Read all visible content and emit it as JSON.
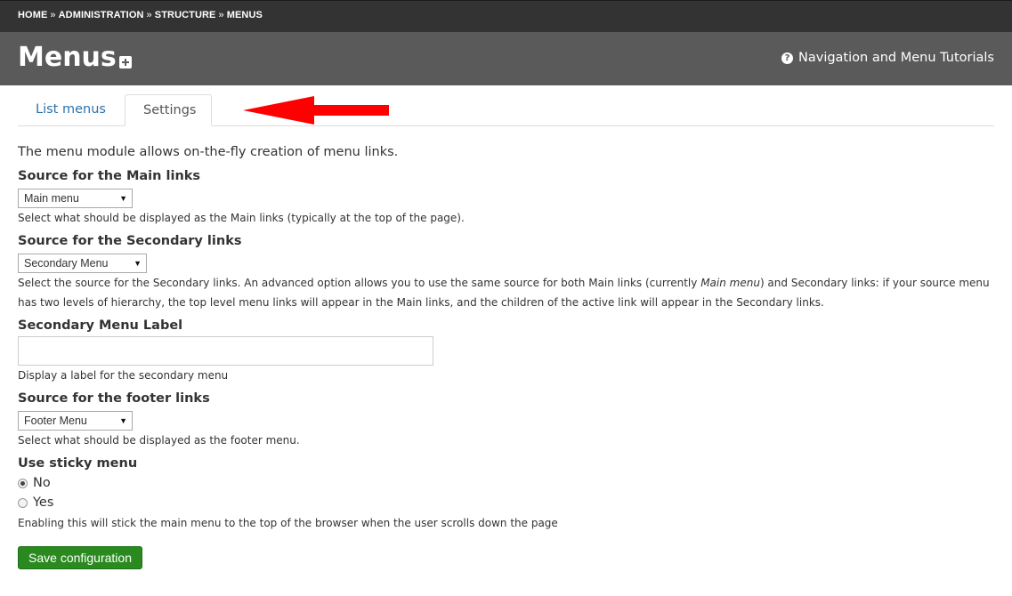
{
  "breadcrumb": {
    "items": [
      "HOME",
      "ADMINISTRATION",
      "STRUCTURE",
      "MENUS"
    ],
    "separator": "»"
  },
  "header": {
    "title": "Menus",
    "help_link": "Navigation and Menu Tutorials",
    "help_icon": "question-circle-icon",
    "add_icon": "plus-square-icon"
  },
  "tabs": [
    {
      "label": "List menus",
      "active": false
    },
    {
      "label": "Settings",
      "active": true
    }
  ],
  "annotation": {
    "icon": "red-arrow-left",
    "color": "#ff0000"
  },
  "form": {
    "intro": "The menu module allows on-the-fly creation of menu links.",
    "main_links": {
      "label": "Source for the Main links",
      "value": "Main menu",
      "description": "Select what should be displayed as the Main links (typically at the top of the page)."
    },
    "secondary_links": {
      "label": "Source for the Secondary links",
      "value": "Secondary Menu",
      "description_part1": "Select the source for the Secondary links. An advanced option allows you to use the same source for both Main links (currently ",
      "description_em": "Main menu",
      "description_part2": ") and Secondary links: if your source menu has two levels of hierarchy, the top level menu links will appear in the Main links, and the children of the active link will appear in the Secondary links."
    },
    "secondary_label": {
      "label": "Secondary Menu Label",
      "value": "",
      "description": "Display a label for the secondary menu"
    },
    "footer_links": {
      "label": "Source for the footer links",
      "value": "Footer Menu",
      "description": "Select what should be displayed as the footer menu."
    },
    "sticky_menu": {
      "label": "Use sticky menu",
      "options": [
        {
          "label": "No",
          "checked": true
        },
        {
          "label": "Yes",
          "checked": false
        }
      ],
      "description": "Enabling this will stick the main menu to the top of the browser when the user scrolls down the page"
    },
    "save_label": "Save configuration"
  },
  "colors": {
    "breadcrumb_bg": "#333333",
    "header_bg": "#5a5a5a",
    "tab_link": "#2b73ad",
    "save_button": "#2a8a1f"
  }
}
